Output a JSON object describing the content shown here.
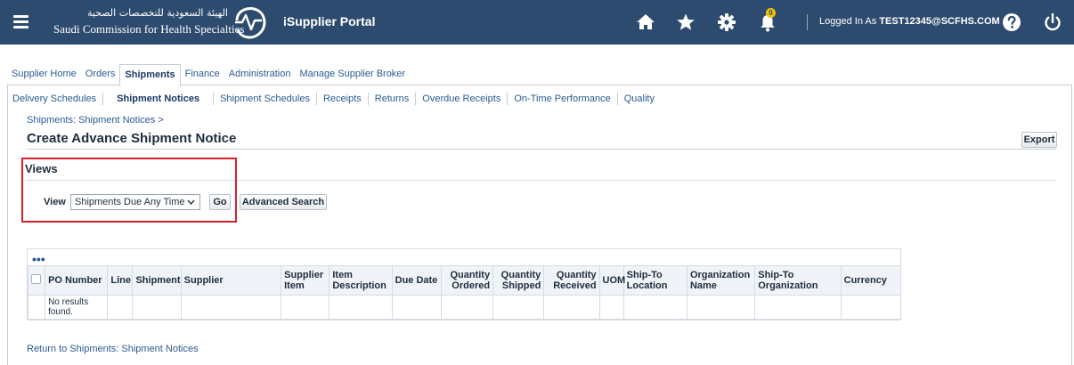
{
  "header": {
    "org_name_ar": "الهيئة السعودية للتخصصات الصحية",
    "org_name_en": "Saudi Commission for Health Specialties",
    "portal_title": "iSupplier Portal",
    "notification_count": "0",
    "logged_in_prefix": "Logged In As",
    "logged_in_user": "TEST12345@SCFHS.COM",
    "icons": [
      "menu-icon",
      "home-icon",
      "star-icon",
      "gear-icon",
      "bell-icon",
      "help-icon",
      "power-icon"
    ],
    "bg_color": "#2d4b6e"
  },
  "tabs": [
    {
      "label": "Supplier Home",
      "active": false
    },
    {
      "label": "Orders",
      "active": false
    },
    {
      "label": "Shipments",
      "active": true
    },
    {
      "label": "Finance",
      "active": false
    },
    {
      "label": "Administration",
      "active": false
    },
    {
      "label": "Manage Supplier Broker",
      "active": false
    }
  ],
  "subtabs": [
    {
      "label": "Delivery Schedules",
      "active": false
    },
    {
      "label": "Shipment Notices",
      "active": true
    },
    {
      "label": "Shipment Schedules",
      "active": false
    },
    {
      "label": "Receipts",
      "active": false
    },
    {
      "label": "Returns",
      "active": false
    },
    {
      "label": "Overdue Receipts",
      "active": false
    },
    {
      "label": "On-Time Performance",
      "active": false
    },
    {
      "label": "Quality",
      "active": false
    }
  ],
  "breadcrumb": "Shipments: Shipment Notices >",
  "page_title": "Create Advance Shipment Notice",
  "export_label": "Export",
  "views": {
    "title": "Views",
    "view_label": "View",
    "selected_view": "Shipments Due Any Time",
    "go_label": "Go",
    "advanced_search_label": "Advanced Search",
    "highlight_color": "#d8202a"
  },
  "table": {
    "menu_glyph": "•••",
    "columns": [
      {
        "label": "",
        "align": "left"
      },
      {
        "label": "PO Number",
        "align": "left"
      },
      {
        "label": "Line",
        "align": "left"
      },
      {
        "label": "Shipment",
        "align": "left"
      },
      {
        "label": "Supplier",
        "align": "left"
      },
      {
        "label": "Supplier Item",
        "align": "left"
      },
      {
        "label": "Item Description",
        "align": "left"
      },
      {
        "label": "Due Date",
        "align": "left"
      },
      {
        "label": "Quantity Ordered",
        "align": "right"
      },
      {
        "label": "Quantity Shipped",
        "align": "right"
      },
      {
        "label": "Quantity Received",
        "align": "right"
      },
      {
        "label": "UOM",
        "align": "left"
      },
      {
        "label": "Ship-To Location",
        "align": "left"
      },
      {
        "label": "Organization Name",
        "align": "left"
      },
      {
        "label": "Ship-To Organization",
        "align": "left"
      },
      {
        "label": "Currency",
        "align": "left"
      }
    ],
    "empty_message": "No results found."
  },
  "return_link": "Return to Shipments: Shipment Notices",
  "link_color": "#2b5b92"
}
